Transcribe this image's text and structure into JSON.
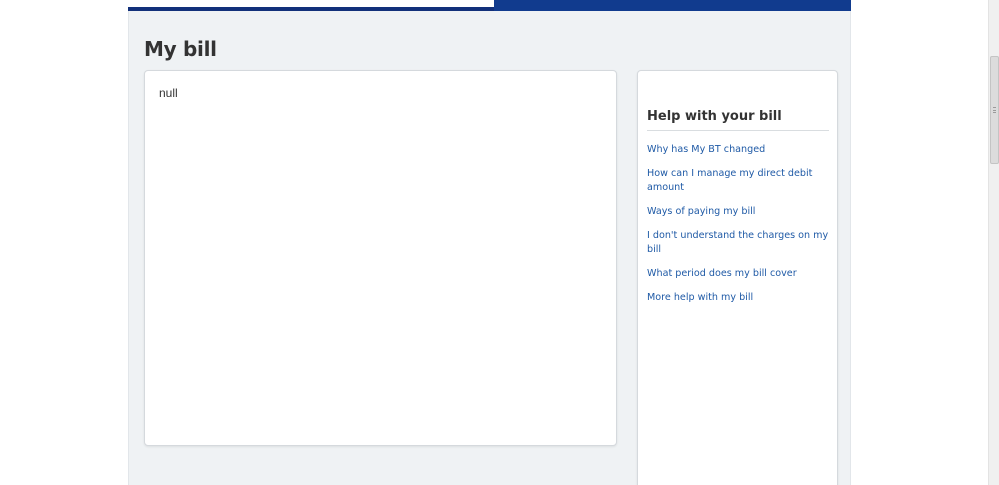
{
  "page": {
    "title": "My bill"
  },
  "bill": {
    "body_text": "null"
  },
  "help": {
    "title": "Help with your bill",
    "links": [
      "Why has My BT changed",
      "How can I manage my direct debit amount",
      "Ways of paying my bill",
      "I don't understand the charges on my bill",
      "What period does my bill cover",
      "More help with my bill"
    ]
  },
  "colors": {
    "brand_blue": "#113b8e",
    "link": "#1f5aa6",
    "content_bg": "#eff2f4"
  }
}
